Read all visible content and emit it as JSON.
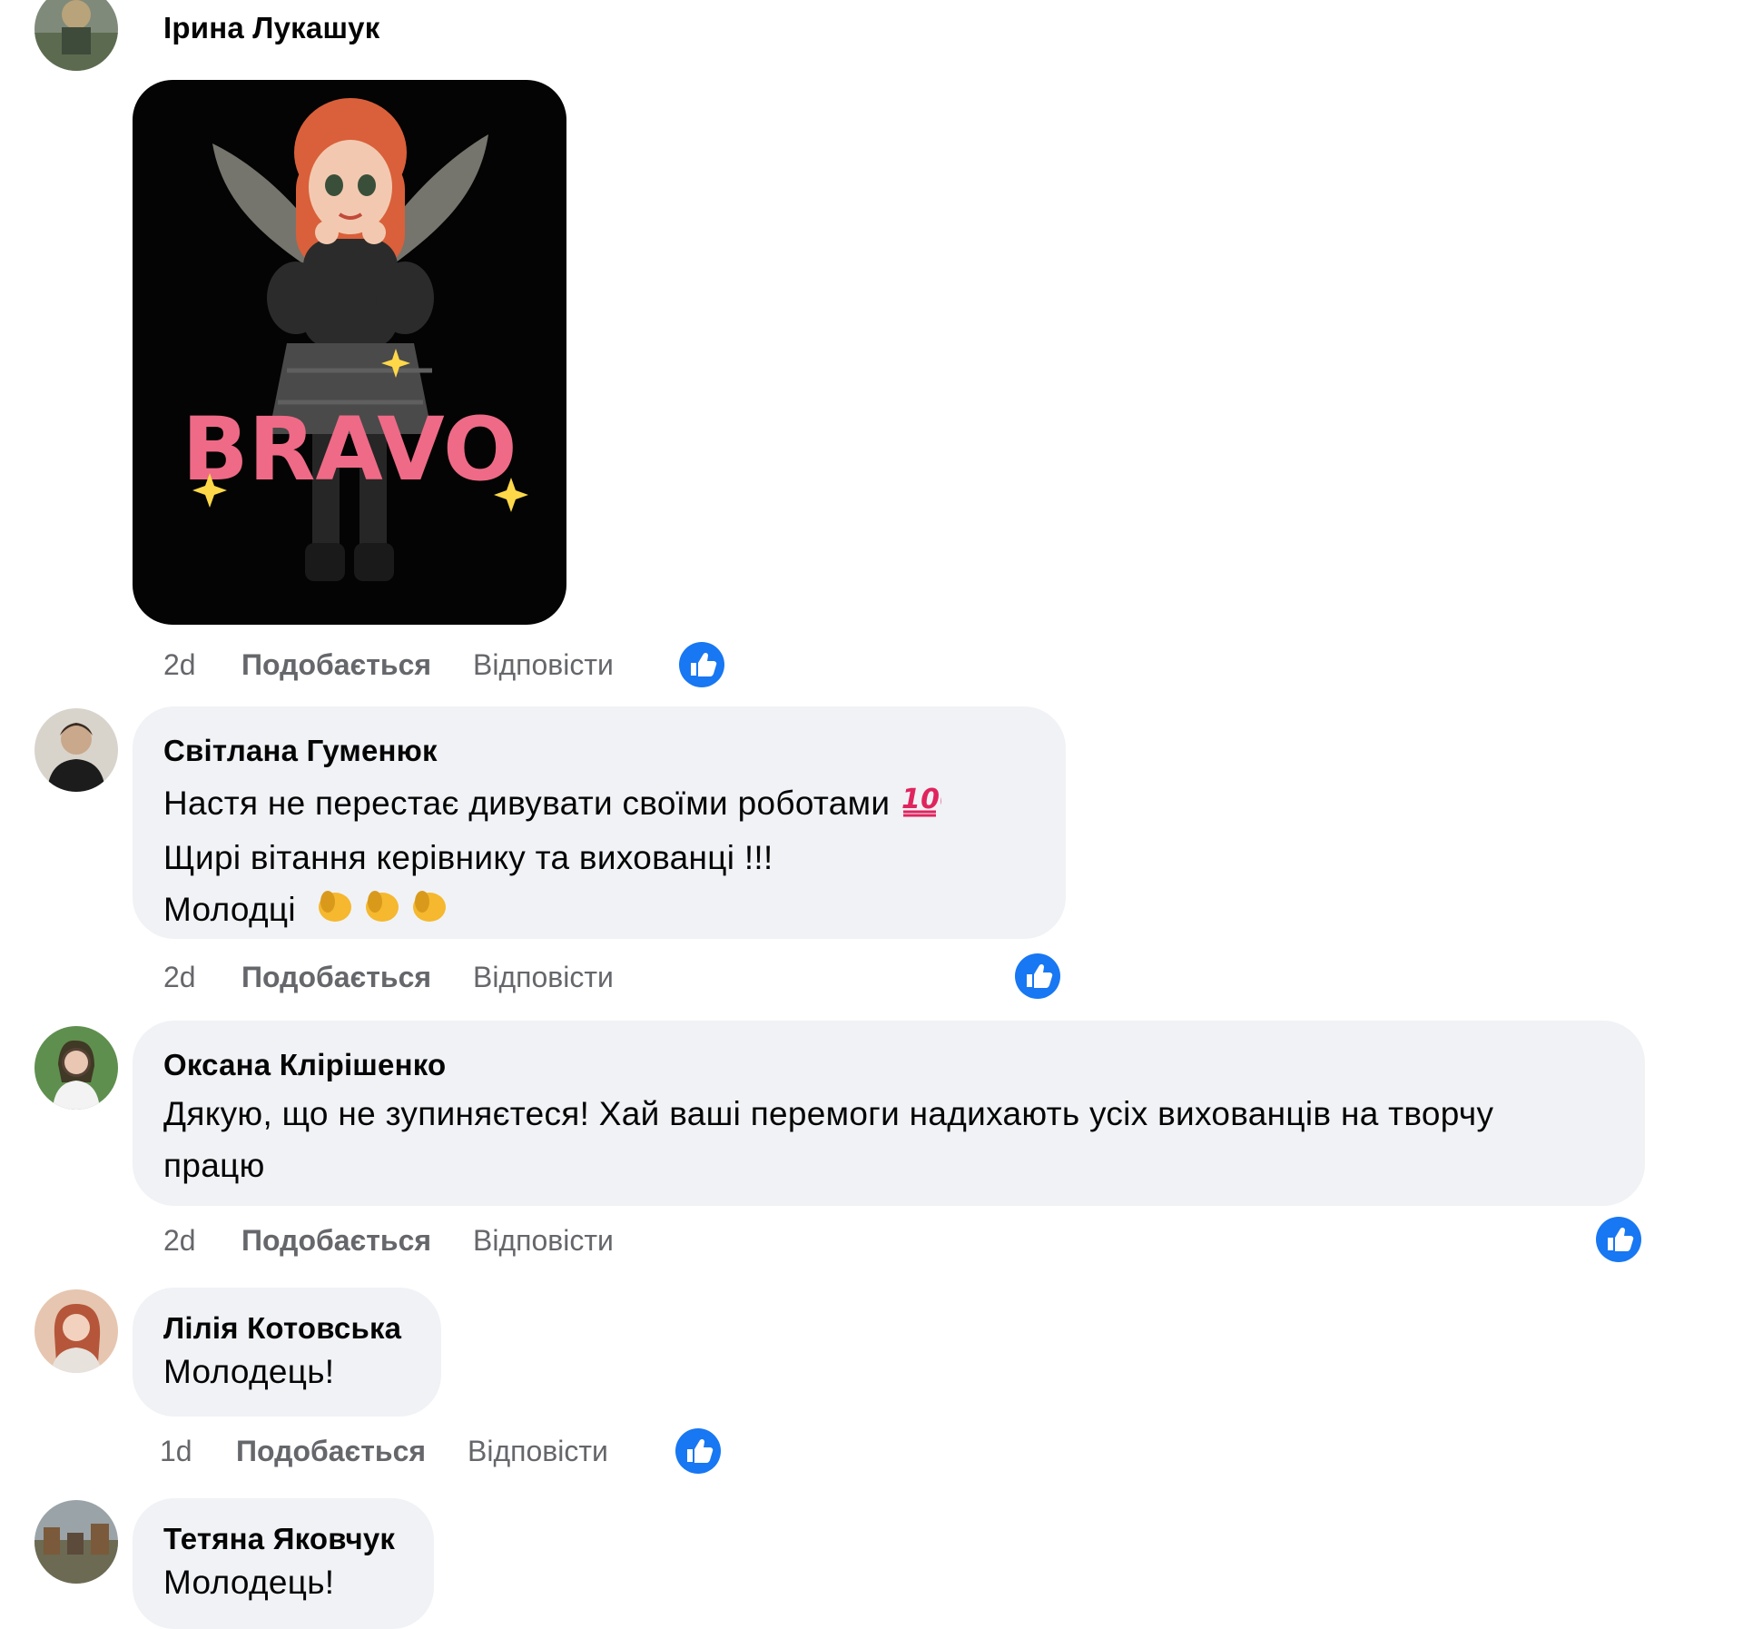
{
  "comments": [
    {
      "author": "Ірина Лукашук",
      "sticker_text": "BRAVO",
      "time": "2d",
      "like_label": "Подобається",
      "reply_label": "Відповісти"
    },
    {
      "author": "Світлана Гуменюк",
      "lines": [
        "Настя не перестає дивувати своїми роботами",
        "Щирі вітання керівнику та вихованці !!!",
        "Молодці"
      ],
      "emojis": [
        "hundred-points-emoji",
        "clapping-hands-emoji"
      ],
      "time": "2d",
      "like_label": "Подобається",
      "reply_label": "Відповісти"
    },
    {
      "author": "Оксана Клірішенко",
      "text": "Дякую, що не зупиняєтеся! Хай ваші перемоги надихають усіх вихованців на творчу працю",
      "time": "2d",
      "like_label": "Подобається",
      "reply_label": "Відповісти"
    },
    {
      "author": "Лілія Котовська",
      "text": "Молодець!",
      "time": "1d",
      "like_label": "Подобається",
      "reply_label": "Відповісти"
    },
    {
      "author": "Тетяна Яковчук",
      "text": "Молодець!"
    }
  ],
  "colors": {
    "bubble": "#f0f2f5",
    "meta_text": "#65676b",
    "like_reaction": "#1877f2"
  },
  "icons": {
    "reaction": "thumbs-up-icon"
  }
}
